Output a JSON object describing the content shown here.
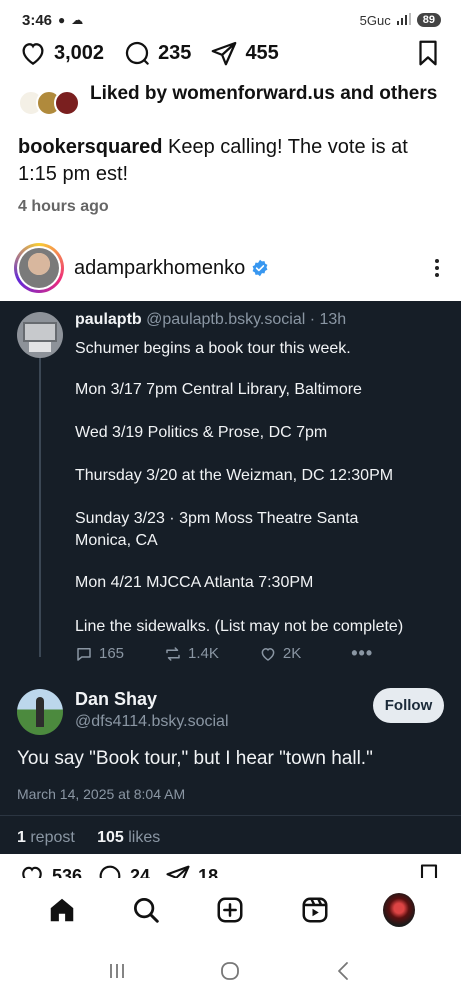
{
  "status_bar": {
    "time": "3:46",
    "network": "5Guc",
    "battery": "89"
  },
  "actions": {
    "likes": "3,002",
    "comments": "235",
    "shares": "455"
  },
  "liked_by": {
    "text": "Liked by womenforward.us and others"
  },
  "caption": {
    "user": "bookersquared",
    "text": " Keep calling! The vote is at 1:15 pm est!"
  },
  "time_ago": "4 hours ago",
  "post": {
    "username": "adamparkhomenko",
    "verified_color": "#3897f0"
  },
  "skeet": {
    "name": "paulaptb",
    "handle": "@paulaptb.bsky.social",
    "time": "13h",
    "lines": [
      "Schumer begins a book tour this week.",
      "Mon 3/17 7pm Central Library, Baltimore",
      "Wed 3/19 Politics & Prose, DC 7pm",
      "Thursday 3/20 at the Weizman, DC 12:30PM",
      "Sunday 3/23 · 3pm  Moss Theatre Santa",
      "Monica, CA",
      "Mon 4/21 MJCCA Atlanta 7:30PM",
      "Line the sidewalks. (List may not be complete)"
    ],
    "replies": "165",
    "reposts": "1.4K",
    "likes": "2K"
  },
  "reply": {
    "name": "Dan Shay",
    "handle": "@dfs4114.bsky.social",
    "follow_label": "Follow",
    "text": "You say \"Book tour,\" but I hear \"town hall.\"",
    "date": "March 14, 2025 at 8:04 AM",
    "repost_count": "1",
    "repost_label": " repost",
    "like_count": "105",
    "like_label": " likes"
  },
  "next_post": {
    "likes": "536",
    "comments": "24",
    "shares": "18"
  },
  "colors": {
    "dark_bg": "#161e27",
    "muted": "#8a96a3",
    "accent": "#3897f0"
  }
}
